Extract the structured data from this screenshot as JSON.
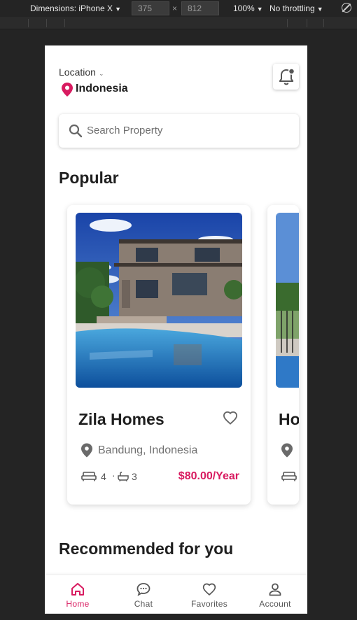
{
  "devtools": {
    "device": "Dimensions: iPhone X",
    "width": "375",
    "height": "812",
    "times": "×",
    "zoom": "100%",
    "throttling": "No throttling"
  },
  "header": {
    "location_label": "Location",
    "location_value": "Indonesia"
  },
  "search": {
    "placeholder": "Search Property"
  },
  "popular": {
    "title": "Popular",
    "cards": [
      {
        "name": "Zila Homes",
        "location": "Bandung, Indonesia",
        "beds": "4",
        "separator": "·",
        "baths": "3",
        "price": "$80.00/Year"
      },
      {
        "name": "Ho"
      }
    ]
  },
  "recommended": {
    "title": "Recommended for you"
  },
  "nav": {
    "items": [
      {
        "label": "Home",
        "icon": "home-icon",
        "active": true
      },
      {
        "label": "Chat",
        "icon": "chat-icon"
      },
      {
        "label": "Favorites",
        "icon": "heart-icon"
      },
      {
        "label": "Account",
        "icon": "account-icon"
      }
    ]
  },
  "colors": {
    "accent": "#d81b60",
    "text": "#1f1f1f",
    "muted": "#707070"
  }
}
